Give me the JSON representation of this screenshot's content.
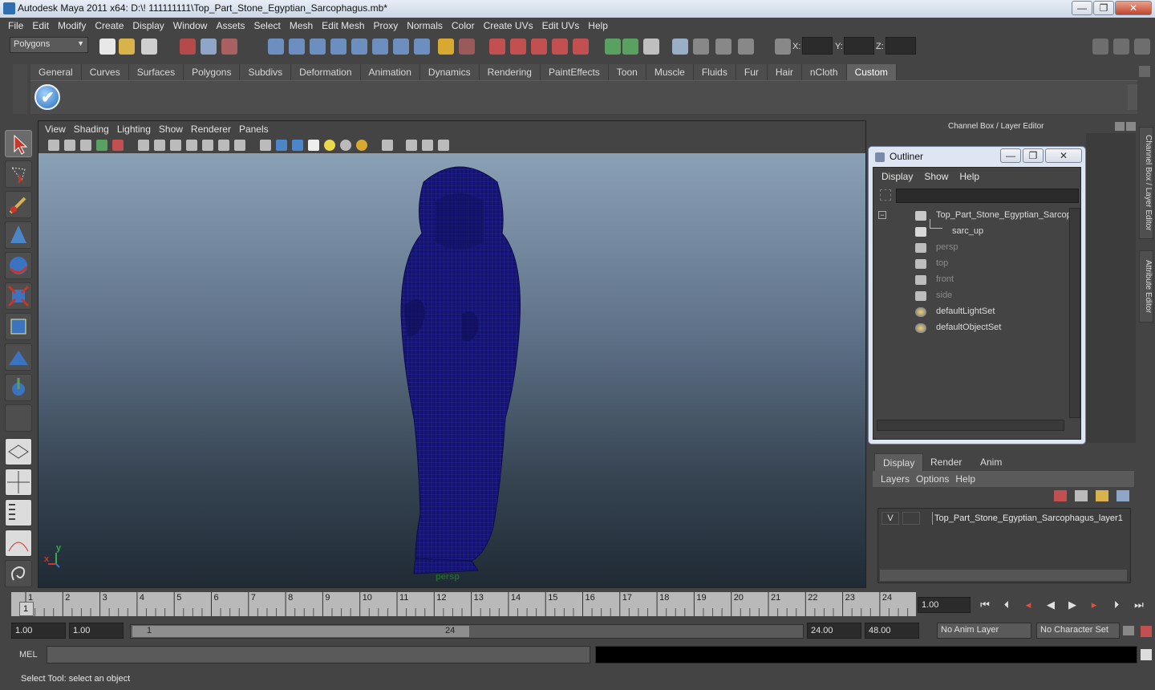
{
  "window": {
    "title": "Autodesk Maya 2011 x64: D:\\! 111111111\\Top_Part_Stone_Egyptian_Sarcophagus.mb*",
    "controls": [
      "—",
      "❐",
      "✕"
    ]
  },
  "menubar": [
    "File",
    "Edit",
    "Modify",
    "Create",
    "Display",
    "Window",
    "Assets",
    "Select",
    "Mesh",
    "Edit Mesh",
    "Proxy",
    "Normals",
    "Color",
    "Create UVs",
    "Edit UVs",
    "Help"
  ],
  "statusline": {
    "menuset": "Polygons",
    "x_label": "X:",
    "y_label": "Y:",
    "z_label": "Z:"
  },
  "shelf": {
    "tabs": [
      "General",
      "Curves",
      "Surfaces",
      "Polygons",
      "Subdivs",
      "Deformation",
      "Animation",
      "Dynamics",
      "Rendering",
      "PaintEffects",
      "Toon",
      "Muscle",
      "Fluids",
      "Fur",
      "Hair",
      "nCloth",
      "Custom"
    ],
    "active_tab": "Custom"
  },
  "viewport": {
    "menu": [
      "View",
      "Shading",
      "Lighting",
      "Show",
      "Renderer",
      "Panels"
    ],
    "camera_label": "persp",
    "axis_x": "x",
    "axis_y": "y"
  },
  "dock": {
    "header": "Channel Box / Layer Editor",
    "side_tabs": [
      "Channel Box / Layer Editor",
      "Attribute Editor"
    ]
  },
  "outliner": {
    "title": "Outliner",
    "menu": [
      "Display",
      "Show",
      "Help"
    ],
    "items": [
      {
        "label": "Top_Part_Stone_Egyptian_Sarcop",
        "icon": "group-icon",
        "indent": 0
      },
      {
        "label": "sarc_up",
        "icon": "mesh-icon",
        "indent": 1
      },
      {
        "label": "persp",
        "icon": "camera-icon",
        "indent": 0,
        "dim": true
      },
      {
        "label": "top",
        "icon": "camera-icon",
        "indent": 0,
        "dim": true
      },
      {
        "label": "front",
        "icon": "camera-icon",
        "indent": 0,
        "dim": true
      },
      {
        "label": "side",
        "icon": "camera-icon",
        "indent": 0,
        "dim": true
      },
      {
        "label": "defaultLightSet",
        "icon": "set-icon",
        "indent": 0
      },
      {
        "label": "defaultObjectSet",
        "icon": "set-icon",
        "indent": 0
      }
    ]
  },
  "layer_editor": {
    "tabs": [
      "Display",
      "Render",
      "Anim"
    ],
    "active_tab": "Display",
    "menu": [
      "Layers",
      "Options",
      "Help"
    ],
    "layer": {
      "visibility": "V",
      "name": "Top_Part_Stone_Egyptian_Sarcophagus_layer1"
    }
  },
  "timeslider": {
    "ticks": [
      "1",
      "2",
      "3",
      "4",
      "5",
      "6",
      "7",
      "8",
      "9",
      "10",
      "11",
      "12",
      "13",
      "14",
      "15",
      "16",
      "17",
      "18",
      "19",
      "20",
      "21",
      "22",
      "23",
      "24"
    ],
    "current_frame_marker": "1",
    "current_time": "1.00"
  },
  "range": {
    "start": "1.00",
    "playback_start": "1.00",
    "slider_start": "1",
    "slider_end": "24",
    "playback_end": "24.00",
    "end": "48.00",
    "anim_layer": "No Anim Layer",
    "character_set": "No Character Set"
  },
  "command_line": {
    "label": "MEL"
  },
  "help_line": "Select Tool: select an object",
  "colors": {
    "ui_bg": "#444444",
    "wireframe": "#1a1a8c",
    "viewport_top": "#8aa0b5",
    "viewport_bottom": "#1f2a34"
  }
}
